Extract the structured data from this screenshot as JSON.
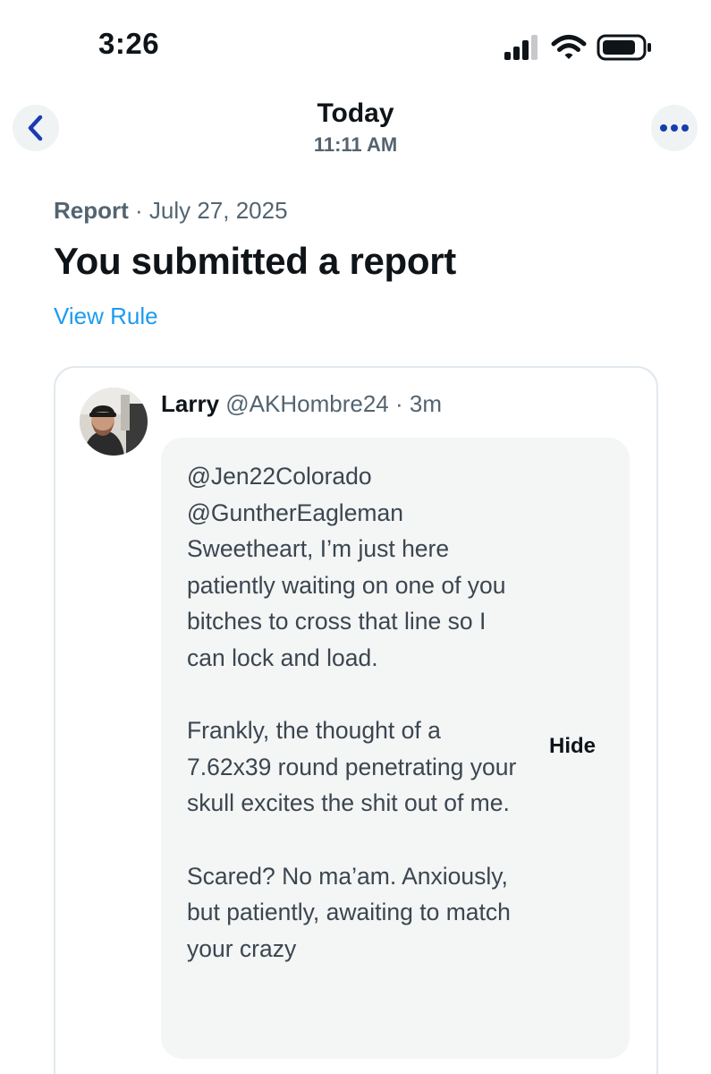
{
  "status_bar": {
    "time": "3:26",
    "icons": [
      "cellular-signal-icon",
      "wifi-icon",
      "battery-icon"
    ]
  },
  "nav": {
    "title": "Today",
    "subtitle": "11:11 AM",
    "back_icon": "chevron-left-icon",
    "more_icon": "ellipsis-icon"
  },
  "report": {
    "type": "Report",
    "separator": " · ",
    "date": "July 27, 2025",
    "title": "You submitted a report",
    "view_rule_label": "View Rule"
  },
  "post": {
    "author_name": "Larry",
    "author_handle": "@AKHombre24",
    "separator": " · ",
    "time_ago": "3m",
    "paragraphs": [
      "@Jen22Colorado @GuntherEagleman Sweetheart, I’m just here patiently waiting on one of you bitches to cross that line so I can lock and load.",
      "Frankly, the thought of a 7.62x39 round penetrating your skull excites the shit out of me.",
      "Scared? No ma’am. Anxiously, but patiently, awaiting to match your crazy"
    ],
    "hide_label": "Hide"
  },
  "colors": {
    "accent_link": "#1d9bf0",
    "nav_icon": "#1a3bb0",
    "secondary_text": "#536471",
    "post_background": "#f4f5f5"
  }
}
